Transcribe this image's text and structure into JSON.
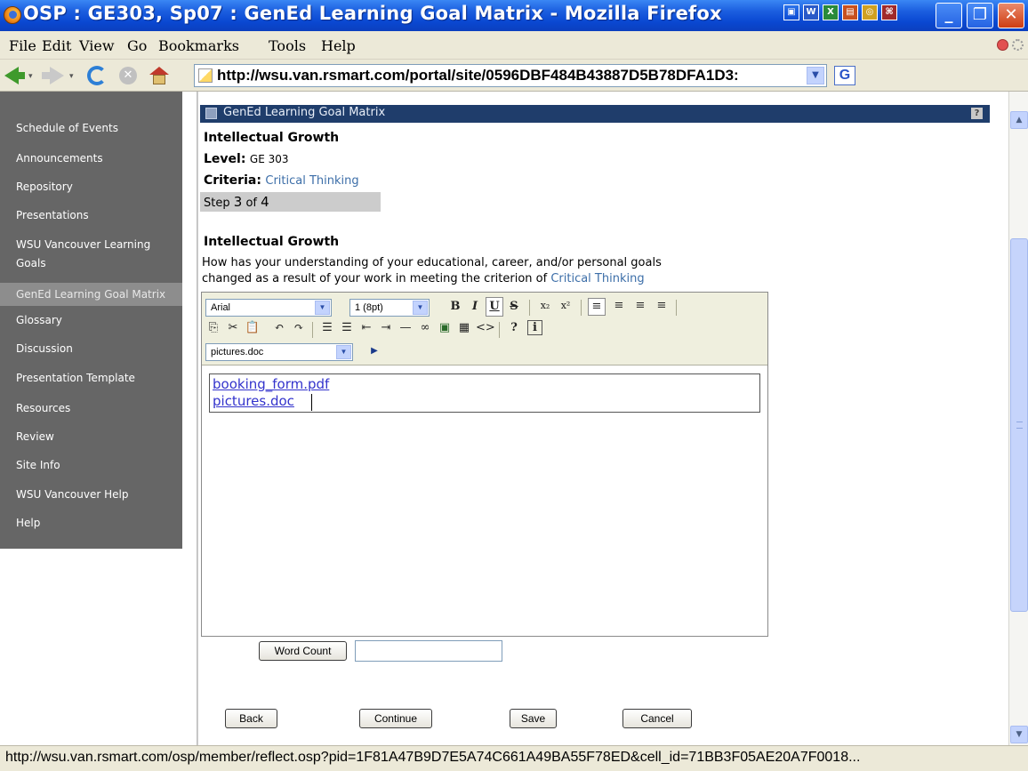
{
  "window": {
    "title": "OSP : GE303, Sp07 : GenEd Learning Goal Matrix - Mozilla Firefox",
    "minimize_label": "_",
    "restore_label": "❐",
    "close_label": "✕",
    "office_icons": [
      "▣",
      "W",
      "X",
      "▤",
      "◎",
      "⌘"
    ]
  },
  "menu": {
    "file": "File",
    "edit": "Edit",
    "view": "View",
    "go": "Go",
    "bookmarks": "Bookmarks",
    "tools": "Tools",
    "help": "Help"
  },
  "navbar": {
    "url": "http://wsu.van.rsmart.com/portal/site/0596DBF484B43887D5B78DFA1D3:",
    "go_label": "G"
  },
  "sidebar": {
    "items": [
      {
        "label": "Schedule of Events",
        "active": false
      },
      {
        "label": "Announcements",
        "active": false
      },
      {
        "label": "Repository",
        "active": false
      },
      {
        "label": "Presentations",
        "active": false
      },
      {
        "label": "WSU Vancouver Learning Goals",
        "active": false
      },
      {
        "label": "GenEd Learning Goal Matrix",
        "active": true
      },
      {
        "label": "Glossary",
        "active": false
      },
      {
        "label": "Discussion",
        "active": false
      },
      {
        "label": "Presentation Template",
        "active": false
      },
      {
        "label": "Resources",
        "active": false
      },
      {
        "label": "Review",
        "active": false
      },
      {
        "label": "Site Info",
        "active": false
      },
      {
        "label": "WSU Vancouver Help",
        "active": false
      },
      {
        "label": "Help",
        "active": false
      }
    ]
  },
  "portlet": {
    "title": "GenEd Learning Goal Matrix",
    "help_label": "?"
  },
  "header": {
    "heading": "Intellectual Growth",
    "level_label": "Level:",
    "level_value": "GE 303",
    "criteria_label": "Criteria:",
    "criteria_value": "Critical Thinking",
    "step_prefix": "Step",
    "step_current": "3",
    "step_of": "of",
    "step_total": "4"
  },
  "question": {
    "heading": "Intellectual Growth",
    "text_line1": "How has your understanding of your educational, career, and/or personal goals",
    "text_line2": "changed as a result of your work in meeting the criterion of",
    "criterion_link": "Critical Thinking"
  },
  "editor": {
    "font_value": "Arial",
    "size_value": "1 (8pt)",
    "attachment_value": "pictures.doc",
    "bold": "B",
    "italic": "I",
    "underline": "U",
    "strike": "S",
    "content_lines": [
      "booking_form.pdf",
      "pictures.doc"
    ]
  },
  "buttons": {
    "word_count": "Word Count",
    "back": "Back",
    "continue": "Continue",
    "save": "Save",
    "cancel": "Cancel"
  },
  "status": {
    "text": "http://wsu.van.rsmart.com/osp/member/reflect.osp?pid=1F81A47B9D7E5A74C661A49BA55F78ED&cell_id=71BB3F05AE20A7F0018..."
  }
}
